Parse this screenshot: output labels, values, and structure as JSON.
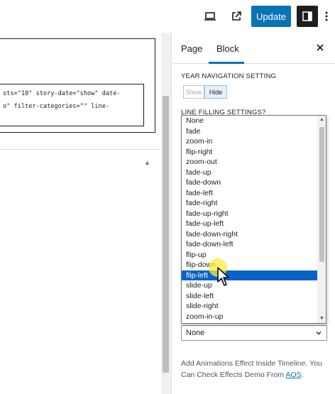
{
  "topbar": {
    "update_label": "Update",
    "icons": [
      "desktop-preview-icon",
      "external-link-icon",
      "sidebar-toggle-icon",
      "more-options-icon"
    ]
  },
  "editor": {
    "code_line_1": "sts=\"10\" story-date=\"show\" date-",
    "code_line_2": "o\" filter-categories=\"\" line-"
  },
  "sidebar": {
    "tabs": [
      {
        "label": "Page",
        "active": false
      },
      {
        "label": "Block",
        "active": true
      }
    ],
    "year_navigation": {
      "label": "YEAR NAVIGATION SETTING",
      "show_label": "Show",
      "hide_label": "Hide",
      "selected": "Hide"
    },
    "line_filling": {
      "label": "LINE FILLING SETTINGS?"
    },
    "animation_select": {
      "value": "None"
    },
    "help_text": "Add Animations Effect Inside Timeline. You Can Check Effects Demo From",
    "help_link": "AOS",
    "help_suffix": "."
  },
  "dropdown": {
    "options": [
      "None",
      "fade",
      "zoom-in",
      "flip-right",
      "zoom-out",
      "fade-up",
      "fade-down",
      "fade-left",
      "fade-right",
      "fade-up-right",
      "fade-up-left",
      "fade-down-right",
      "fade-down-left",
      "flip-up",
      "flip-down",
      "flip-left",
      "slide-up",
      "slide-left",
      "slide-right",
      "zoom-in-up"
    ],
    "highlighted": "flip-left"
  },
  "colors": {
    "accent": "#0a73b6",
    "selection": "#0a62c9",
    "cursor_highlight": "#ffec3c"
  }
}
